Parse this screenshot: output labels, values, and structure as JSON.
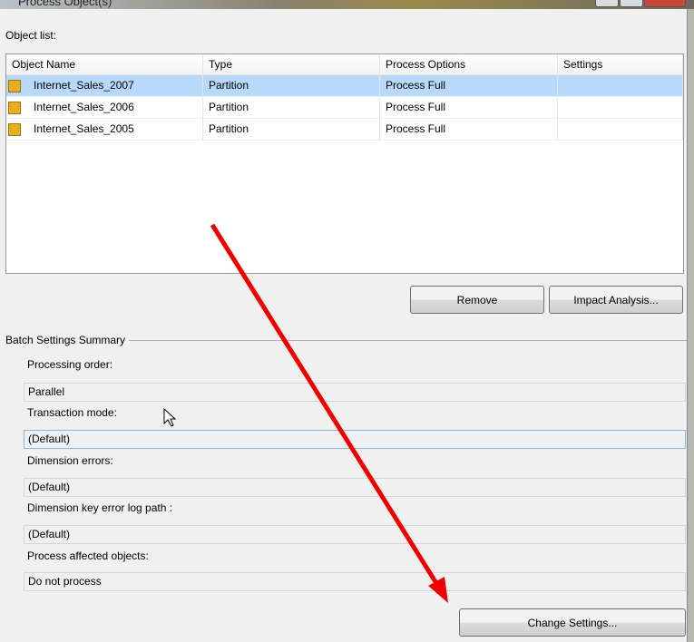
{
  "window": {
    "title": "Process Object(s)"
  },
  "object_list": {
    "label": "Object list:",
    "columns": [
      "Object Name",
      "Type",
      "Process Options",
      "Settings"
    ],
    "rows": [
      {
        "name": "Internet_Sales_2007",
        "type": "Partition",
        "options": "Process Full",
        "settings": ""
      },
      {
        "name": "Internet_Sales_2006",
        "type": "Partition",
        "options": "Process Full",
        "settings": ""
      },
      {
        "name": "Internet_Sales_2005",
        "type": "Partition",
        "options": "Process Full",
        "settings": ""
      }
    ]
  },
  "buttons": {
    "remove": "Remove",
    "impact": "Impact Analysis...",
    "change": "Change Settings..."
  },
  "batch": {
    "title": "Batch Settings Summary",
    "fields": [
      {
        "label": "Processing order:",
        "value": "Parallel"
      },
      {
        "label": "Transaction mode:",
        "value": "(Default)"
      },
      {
        "label": "Dimension errors:",
        "value": "(Default)"
      },
      {
        "label": "Dimension key error log path :",
        "value": "(Default)"
      },
      {
        "label": "Process affected objects:",
        "value": "Do not process"
      }
    ]
  }
}
